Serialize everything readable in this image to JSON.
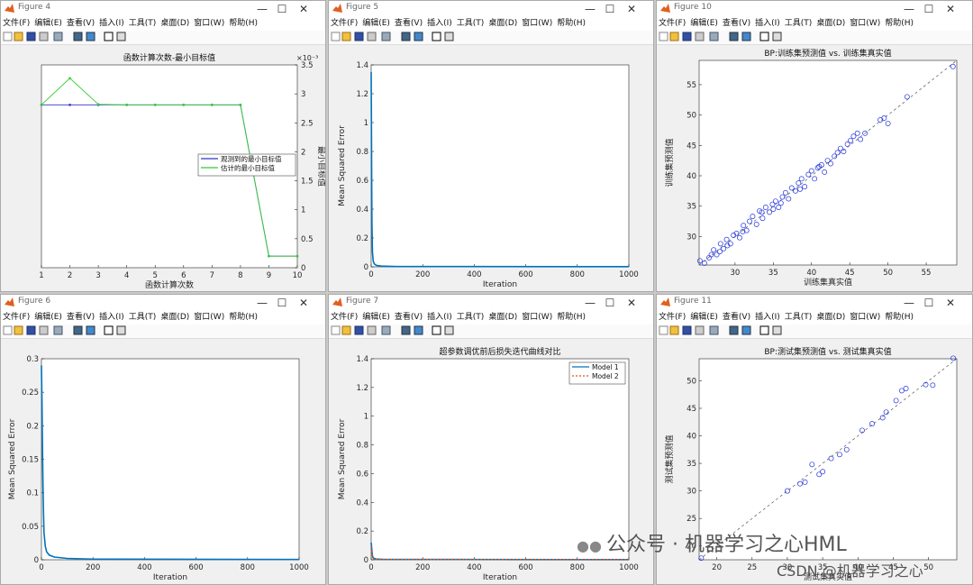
{
  "windows": [
    {
      "id": "fig4",
      "title": "Figure 4",
      "menus": [
        "文件(F)",
        "编辑(E)",
        "查看(V)",
        "插入(I)",
        "工具(T)",
        "桌面(D)",
        "窗口(W)",
        "帮助(H)"
      ],
      "chart": {
        "type": "line",
        "title": "函数计算次数-最小目标值",
        "xlabel": "函数计算次数",
        "ylabel": "最小目标值",
        "exponent_label": "×10⁻³",
        "xlim": [
          1,
          10
        ],
        "ylim": [
          0,
          3.5
        ],
        "xticks": [
          "1",
          "2",
          "3",
          "4",
          "5",
          "6",
          "7",
          "8",
          "9",
          "10"
        ],
        "yticks": [
          "0",
          "0.5",
          "1",
          "1.5",
          "2",
          "2.5",
          "3",
          "3.5"
        ],
        "x": [
          1,
          2,
          3,
          4,
          5,
          6,
          7,
          8,
          9,
          10
        ],
        "series": [
          {
            "name": "观测到的最小目标值",
            "color": "#3333cc",
            "values": [
              2.81,
              2.81,
              2.81,
              2.81,
              2.81,
              2.81,
              2.81,
              2.81,
              0.2,
              0.2
            ]
          },
          {
            "name": "估计的最小目标值",
            "color": "#33cc33",
            "values": [
              2.81,
              3.27,
              2.82,
              2.81,
              2.81,
              2.81,
              2.81,
              2.81,
              0.2,
              0.2
            ]
          }
        ],
        "legend_position": "right"
      }
    },
    {
      "id": "fig5",
      "title": "Figure 5",
      "menus": [
        "文件(F)",
        "编辑(E)",
        "查看(V)",
        "插入(I)",
        "工具(T)",
        "桌面(D)",
        "窗口(W)",
        "帮助(H)"
      ],
      "chart": {
        "type": "line",
        "title": "",
        "xlabel": "Iteration",
        "ylabel": "Mean Squared Error",
        "xlim": [
          0,
          1000
        ],
        "ylim": [
          0,
          1.4
        ],
        "xticks": [
          "0",
          "200",
          "400",
          "600",
          "800",
          "1000"
        ],
        "yticks": [
          "0",
          "0.2",
          "0.4",
          "0.6",
          "0.8",
          "1",
          "1.2",
          "1.4"
        ],
        "series": [
          {
            "color": "#0072bd",
            "x": [
              0,
              1,
              2,
              3,
              5,
              8,
              12,
              20,
              40,
              100,
              1000
            ],
            "values": [
              1.35,
              1.0,
              0.6,
              0.3,
              0.1,
              0.04,
              0.02,
              0.01,
              0.005,
              0.002,
              0.001
            ]
          }
        ]
      }
    },
    {
      "id": "fig10",
      "title": "Figure 10",
      "menus": [
        "文件(F)",
        "编辑(E)",
        "查看(V)",
        "插入(I)",
        "工具(T)",
        "桌面(D)",
        "窗口(W)",
        "帮助(H)"
      ],
      "chart": {
        "type": "scatter",
        "title": "BP:训练集预测值 vs. 训练集真实值",
        "xlabel": "训练集真实值",
        "ylabel": "训练集预测值",
        "xlim": [
          25.3,
          59
        ],
        "ylim": [
          25.3,
          59
        ],
        "xticks": [
          "30",
          "35",
          "40",
          "45",
          "50",
          "55"
        ],
        "yticks": [
          "30",
          "35",
          "40",
          "45",
          "50",
          "55"
        ],
        "x": [
          25.4,
          26.6,
          26.9,
          27.2,
          27.6,
          28.1,
          28.5,
          28.9,
          29.4,
          29.8,
          30.2,
          30.6,
          31.1,
          31.5,
          31.9,
          32.3,
          32.8,
          33.2,
          33.6,
          34.0,
          34.5,
          34.9,
          35.3,
          35.7,
          36.2,
          36.6,
          37.0,
          37.4,
          37.9,
          38.3,
          38.7,
          39.1,
          39.6,
          40.0,
          40.4,
          40.8,
          41.3,
          41.7,
          42.1,
          42.5,
          43.0,
          43.4,
          43.8,
          44.2,
          44.7,
          45.1,
          45.5,
          46.0,
          46.4,
          47.0,
          49.0,
          49.5,
          50.0,
          52.5,
          58.5,
          26.0,
          28.0,
          31.0,
          33.5,
          36.0,
          38.5,
          41.0,
          29.0,
          35.0
        ],
        "y": [
          26.0,
          26.5,
          27.0,
          27.8,
          27.0,
          28.8,
          28.0,
          29.5,
          28.8,
          30.2,
          30.5,
          29.8,
          31.8,
          31.0,
          32.5,
          33.3,
          32.0,
          34.2,
          33.0,
          34.8,
          34.0,
          35.3,
          35.8,
          34.8,
          36.5,
          37.2,
          36.2,
          38.0,
          37.5,
          38.8,
          39.5,
          38.2,
          40.2,
          40.8,
          39.5,
          41.3,
          41.8,
          40.6,
          42.5,
          42.0,
          43.2,
          43.8,
          44.5,
          44.0,
          45.2,
          45.8,
          46.5,
          47.0,
          46.0,
          47.0,
          49.2,
          49.5,
          48.6,
          53.0,
          58.0,
          25.6,
          27.5,
          30.8,
          34.0,
          35.5,
          37.8,
          41.5,
          28.5,
          34.5
        ],
        "reference_line": true
      }
    },
    {
      "id": "fig6",
      "title": "Figure 6",
      "menus": [
        "文件(F)",
        "编辑(E)",
        "查看(V)",
        "插入(I)",
        "工具(T)",
        "桌面(D)",
        "窗口(W)",
        "帮助(H)"
      ],
      "chart": {
        "type": "line",
        "title": "",
        "xlabel": "Iteration",
        "ylabel": "Mean Squared Error",
        "xlim": [
          0,
          1000
        ],
        "ylim": [
          0,
          0.3
        ],
        "xticks": [
          "0",
          "200",
          "400",
          "600",
          "800",
          "1000"
        ],
        "yticks": [
          "0",
          "0.05",
          "0.1",
          "0.15",
          "0.2",
          "0.25",
          "0.3"
        ],
        "series": [
          {
            "color": "#0072bd",
            "x": [
              0,
              2,
              4,
              6,
              8,
              10,
              15,
              20,
              30,
              50,
              100,
              200,
              1000
            ],
            "values": [
              0.29,
              0.24,
              0.17,
              0.11,
              0.07,
              0.04,
              0.02,
              0.012,
              0.007,
              0.004,
              0.002,
              0.001,
              0.0005
            ]
          }
        ]
      }
    },
    {
      "id": "fig7",
      "title": "Figure 7",
      "menus": [
        "文件(F)",
        "编辑(E)",
        "查看(V)",
        "插入(I)",
        "工具(T)",
        "桌面(D)",
        "窗口(W)",
        "帮助(H)"
      ],
      "chart": {
        "type": "line",
        "title": "超参数调优前后损失迭代曲线对比",
        "xlabel": "Iteration",
        "ylabel": "Mean Squared Error",
        "xlim": [
          0,
          1000
        ],
        "ylim": [
          0,
          1.4
        ],
        "xticks": [
          "0",
          "200",
          "400",
          "600",
          "800",
          "1000"
        ],
        "yticks": [
          "0",
          "0.2",
          "0.4",
          "0.6",
          "0.8",
          "1",
          "1.2",
          "1.4"
        ],
        "series": [
          {
            "name": "Model 1",
            "color": "#0072bd",
            "dash": "",
            "x": [
              0,
              2,
              4,
              6,
              10,
              20,
              50,
              1000
            ],
            "values": [
              0.12,
              0.08,
              0.04,
              0.02,
              0.01,
              0.005,
              0.002,
              0.001
            ]
          },
          {
            "name": "Model 2",
            "color": "#d95319",
            "dash": "2,2",
            "x": [
              0,
              2,
              4,
              6,
              10,
              20,
              50,
              1000
            ],
            "values": [
              0.09,
              0.06,
              0.03,
              0.015,
              0.008,
              0.004,
              0.002,
              0.001
            ]
          }
        ],
        "legend_position": "top-right"
      }
    },
    {
      "id": "fig11",
      "title": "Figure 11",
      "menus": [
        "文件(F)",
        "编辑(E)",
        "查看(V)",
        "插入(I)",
        "工具(T)",
        "桌面(D)",
        "窗口(W)",
        "帮助(H)"
      ],
      "chart": {
        "type": "scatter",
        "title": "BP:测试集预测值 vs. 测试集真实值",
        "xlabel": "测试集真实值",
        "ylabel": "测试集预测值",
        "xlim": [
          17.5,
          54
        ],
        "ylim": [
          17.5,
          54
        ],
        "xticks": [
          "20",
          "25",
          "30",
          "35",
          "40",
          "45",
          "50"
        ],
        "yticks": [
          "20",
          "25",
          "30",
          "35",
          "40",
          "45",
          "50"
        ],
        "x": [
          17.8,
          30.0,
          31.8,
          32.5,
          33.5,
          34.5,
          35.0,
          36.2,
          37.4,
          38.4,
          40.6,
          42.0,
          43.5,
          44.0,
          45.4,
          46.2,
          46.8,
          49.6,
          50.6,
          53.5
        ],
        "y": [
          17.8,
          30.0,
          31.3,
          31.6,
          34.8,
          33.0,
          33.5,
          35.9,
          36.6,
          37.5,
          41.0,
          42.2,
          43.3,
          44.3,
          46.4,
          48.2,
          48.6,
          49.3,
          49.2,
          54.1
        ],
        "reference_line": true
      }
    }
  ],
  "watermark": {
    "line1": "公众号 · 机器学习之心HML",
    "line2": "CSDN @机器学习之心"
  }
}
